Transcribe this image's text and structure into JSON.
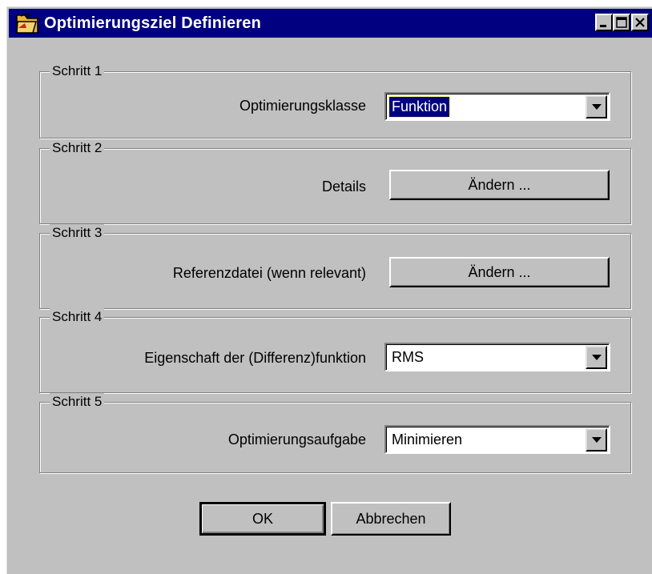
{
  "window": {
    "title": "Optimierungsziel Definieren",
    "controls": [
      "minimize-icon",
      "maximize-icon",
      "close-icon"
    ]
  },
  "steps": [
    {
      "legend": "Schritt 1",
      "label": "Optimierungsklasse",
      "control": "combo",
      "value": "Funktion"
    },
    {
      "legend": "Schritt 2",
      "label": "Details",
      "control": "button",
      "value": "Ändern ..."
    },
    {
      "legend": "Schritt 3",
      "label": "Referenzdatei (wenn relevant)",
      "control": "button",
      "value": "Ändern ..."
    },
    {
      "legend": "Schritt 4",
      "label": "Eigenschaft der (Differenz)funktion",
      "control": "combo",
      "value": "RMS"
    },
    {
      "legend": "Schritt 5",
      "label": "Optimierungsaufgabe",
      "control": "combo",
      "value": "Minimieren"
    }
  ],
  "footer": {
    "ok_label": "OK",
    "cancel_label": "Abbrechen"
  },
  "colors": {
    "titlebar": "#000080",
    "face": "#c0c0c0"
  }
}
